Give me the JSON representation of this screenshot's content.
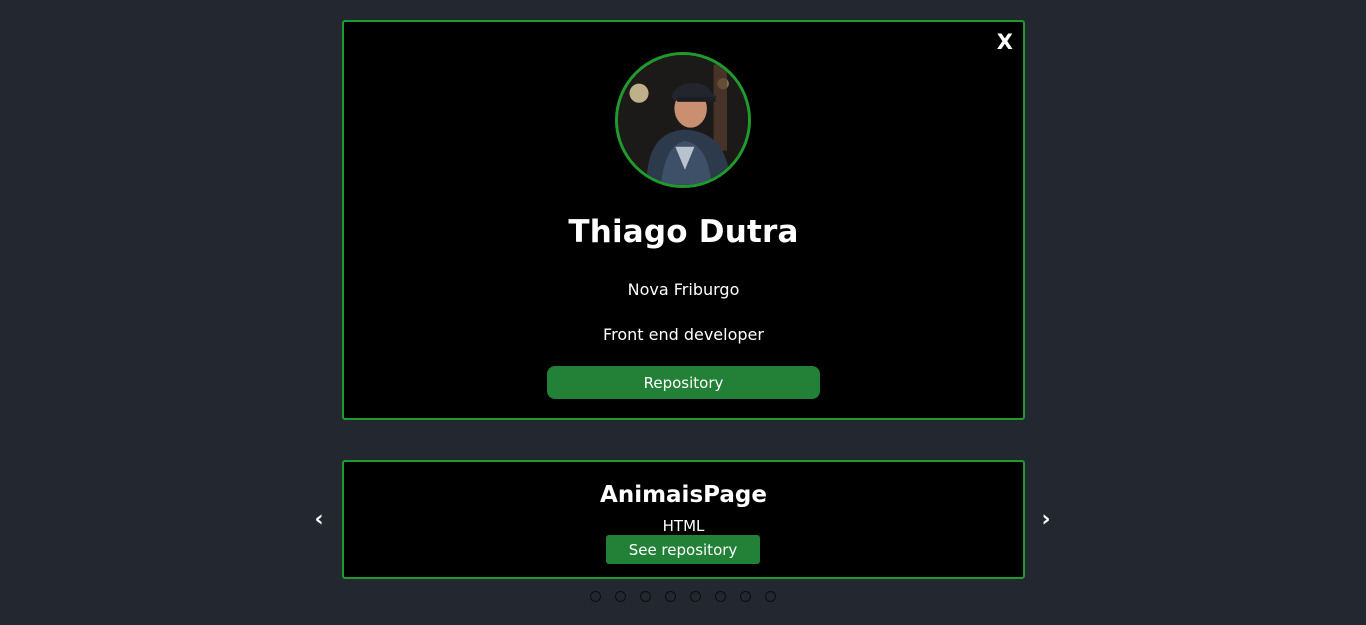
{
  "profile": {
    "close_label": "X",
    "name": "Thiago Dutra",
    "city": "Nova Friburgo",
    "role": "Front end developer",
    "repository_label": "Repository"
  },
  "carousel": {
    "prev_label": "‹",
    "next_label": "›",
    "project": {
      "title": "AnimaisPage",
      "language": "HTML",
      "button_label": "See repository"
    },
    "dot_count": 8,
    "active_dot": 0
  },
  "colors": {
    "background": "#23272f",
    "card": "#000000",
    "accent_border": "#1f9a2c",
    "button": "#228137"
  }
}
